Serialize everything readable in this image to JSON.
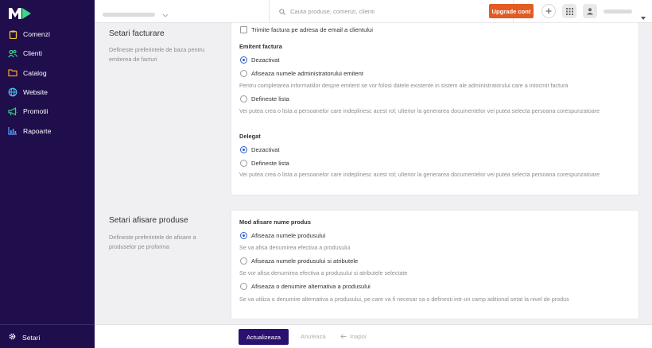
{
  "app": {
    "brand_color": "#1f0d4c",
    "accent_color": "#2a5fc9",
    "upgrade_color": "#e35a24"
  },
  "sidebar": {
    "items": [
      {
        "label": "Comenzi",
        "icon": "clipboard-icon",
        "color": "#f2c434"
      },
      {
        "label": "Clienti",
        "icon": "users-icon",
        "color": "#3dd68c"
      },
      {
        "label": "Catalog",
        "icon": "folder-icon",
        "color": "#f29a2e"
      },
      {
        "label": "Website",
        "icon": "globe-icon",
        "color": "#4fc4ea"
      },
      {
        "label": "Promotii",
        "icon": "megaphone-icon",
        "color": "#36d27a"
      },
      {
        "label": "Rapoarte",
        "icon": "chart-icon",
        "color": "#5aa6ff"
      }
    ],
    "settings_label": "Setari"
  },
  "topbar": {
    "search_placeholder": "Cauta produse, comenzi, clienti",
    "upgrade_label": "Upgrade cont"
  },
  "invoice_section": {
    "title": "Setari facturare",
    "description": "Defineste preferintele de baza pentru emiterea de facturi",
    "send_email_label": "Trimite factura pe adresa de email a clientului",
    "issuer": {
      "label": "Emitent factura",
      "options": [
        {
          "label": "Dezactivat",
          "selected": true
        },
        {
          "label": "Afiseaza numele administratorului emitent",
          "selected": false
        },
        {
          "label": "Defineste lista",
          "selected": false
        }
      ],
      "hint_admin": "Pentru completarea informatiilor despre emitent se vor folosi datele existente in sistem ale administratorului care a intocmit factura",
      "hint_list": "Vei putea crea o lista a persoanelor care indeplinesc acest rol; ulterior la generarea documentelor vei putea selecta persoana corespunzatoare"
    },
    "delegate": {
      "label": "Delegat",
      "options": [
        {
          "label": "Dezactivat",
          "selected": true
        },
        {
          "label": "Defineste lista",
          "selected": false
        }
      ],
      "hint_list": "Vei putea crea o lista a persoanelor care indeplinesc acest rol; ulterior la generarea documentelor vei putea selecta persoana corespunzatoare"
    }
  },
  "product_section": {
    "title": "Setari afisare produse",
    "description": "Defineste preferintele de afisare a produselor pe proforma",
    "mode_label": "Mod afisare nume produs",
    "options": [
      {
        "label": "Afiseaza numele produsului",
        "hint": "Se va afisa denumirea efectiva a produsului",
        "selected": true
      },
      {
        "label": "Afiseaza numele produsului si atributele",
        "hint": "Se vor afisa denumirea efectiva a produsului si atributele selectate",
        "selected": false
      },
      {
        "label": "Afiseaza o denumire alternativa a produsului",
        "hint": "Se va utiliza o denumire alternativa a produsului, pe care va fi necesar sa o definesti intr-un camp aditional setat la nivel de produs",
        "selected": false
      }
    ]
  },
  "footer": {
    "update_label": "Actualizeaza",
    "cancel_label": "Anuleaza",
    "back_label": "Inapoi"
  }
}
